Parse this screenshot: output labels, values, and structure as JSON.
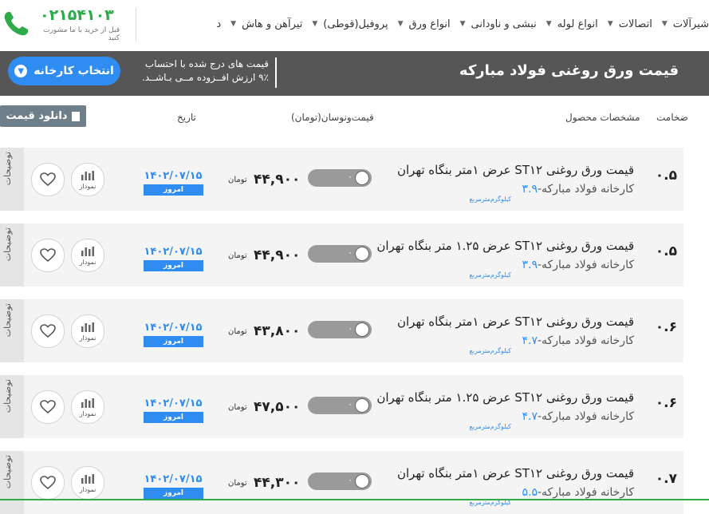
{
  "nav": {
    "phone": "۰۲۱۵۴۱۰۳",
    "phone_caption": "قبل از خرید با ما مشورت کنید",
    "menu": [
      "شیرآلات",
      "اتصالات",
      "انواع لوله",
      "نبشی و ناودانی",
      "انواع ورق",
      "پروفیل(قوطی)",
      "تیرآهن و هاش",
      "د"
    ]
  },
  "banner": {
    "title": "قیمت ورق روغنی فولاد مبارکه",
    "note_line1": "قیمت های درج شده با احتساب",
    "note_line2": "۹٪ ارزش افــزوده مــی بـاشــد.",
    "factory_button": "انتخاب کارخانه"
  },
  "table": {
    "download_label": "دانلود قیمت",
    "headers": {
      "thickness": "ضخامت",
      "specs": "مشخصات محصول",
      "price": "قیمت‌ونوسان(تومان)",
      "date": "تاریخ"
    },
    "rows": [
      {
        "thickness": "۰.۵",
        "title": "قیمت ورق روغنی ST۱۲ عرض ۱متر بنگاه تهران",
        "factory": "کارخانه فولاد مبارکه-",
        "weight": "۳.۹",
        "weight_unit": "کیلوگرم‌متر‌مربع",
        "toggle": "۰",
        "price": "۴۴,۹۰۰",
        "unit": "تومان",
        "date": "۱۴۰۲/۰۷/۱۵",
        "today": "امروز",
        "chart": "نمودار",
        "desc": "توضیحات"
      },
      {
        "thickness": "۰.۵",
        "title": "قیمت ورق روغنی ST۱۲ عرض ۱.۲۵ متر بنگاه تهران",
        "factory": "کارخانه فولاد مبارکه-",
        "weight": "۳.۹",
        "weight_unit": "کیلوگرم‌متر‌مربع",
        "toggle": "۰",
        "price": "۴۴,۹۰۰",
        "unit": "تومان",
        "date": "۱۴۰۲/۰۷/۱۵",
        "today": "امروز",
        "chart": "نمودار",
        "desc": "توضیحات"
      },
      {
        "thickness": "۰.۶",
        "title": "قیمت ورق روغنی ST۱۲ عرض ۱متر بنگاه تهران",
        "factory": "کارخانه فولاد مبارکه-",
        "weight": "۴.۷",
        "weight_unit": "کیلوگرم‌متر‌مربع",
        "toggle": "۰",
        "price": "۴۳,۸۰۰",
        "unit": "تومان",
        "date": "۱۴۰۲/۰۷/۱۵",
        "today": "امروز",
        "chart": "نمودار",
        "desc": "توضیحات"
      },
      {
        "thickness": "۰.۶",
        "title": "قیمت ورق روغنی ST۱۲ عرض ۱.۲۵ متر بنگاه تهران",
        "factory": "کارخانه فولاد مبارکه-",
        "weight": "۴.۷",
        "weight_unit": "کیلوگرم‌متر‌مربع",
        "toggle": "۰",
        "price": "۴۷,۵۰۰",
        "unit": "تومان",
        "date": "۱۴۰۲/۰۷/۱۵",
        "today": "امروز",
        "chart": "نمودار",
        "desc": "توضیحات"
      },
      {
        "thickness": "۰.۷",
        "title": "قیمت ورق روغنی ST۱۲ عرض ۱متر بنگاه تهران",
        "factory": "کارخانه فولاد مبارکه-",
        "weight": "۵.۵",
        "weight_unit": "کیلوگرم‌متر‌مربع",
        "toggle": "۰",
        "price": "۴۴,۳۰۰",
        "unit": "تومان",
        "date": "۱۴۰۲/۰۷/۱۵",
        "today": "امروز",
        "chart": "نمودار",
        "desc": "توضیحات"
      }
    ]
  },
  "colors": {
    "accent": "#2f8df2",
    "brand_green": "#2eaa4a",
    "banner": "#565656"
  }
}
